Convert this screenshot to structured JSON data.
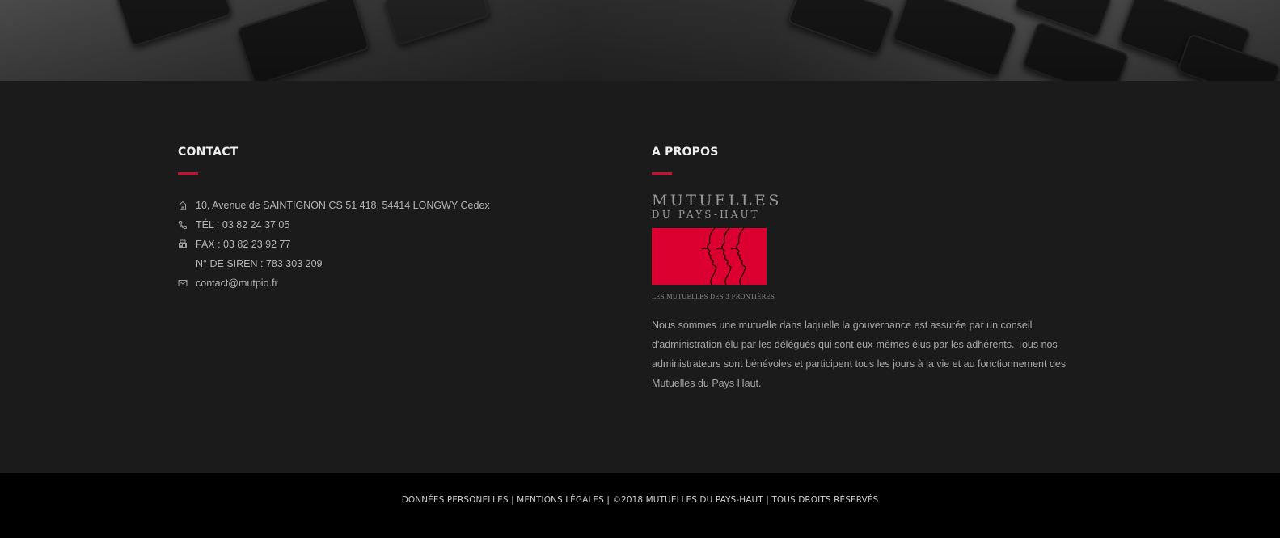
{
  "contact": {
    "title": "CONTACT",
    "items": [
      {
        "icon": "home-icon",
        "text": "10, Avenue de SAINTIGNON CS 51 418, 54414 LONGWY Cedex"
      },
      {
        "icon": "phone-icon",
        "text": "TÉL : 03 82 24 37 05"
      },
      {
        "icon": "fax-icon",
        "text": "FAX : 03 82 23 92 77"
      },
      {
        "icon": "",
        "text": "N° DE SIREN : 783 303 209"
      },
      {
        "icon": "mail-icon",
        "text": "contact@mutpio.fr"
      }
    ]
  },
  "about": {
    "title": "A PROPOS",
    "logo": {
      "line1": "MUTUELLES",
      "line2": "DU PAYS-HAUT",
      "tagline": "LES MUTUELLES DES 3 FRONTIÈRES"
    },
    "text": "Nous sommes une mutuelle dans laquelle la gouvernance est assurée par un conseil d'administration élu par les délégués qui sont eux-mêmes élus par les adhérents. Tous nos administrateurs sont bénévoles et participent tous les jours à la vie et au fonctionnement des Mutuelles du Pays Haut."
  },
  "bottom": {
    "link1": "DONNÉES PERSONELLES",
    "link2": "MENTIONS LÉGALES",
    "copyright": "©2018 MUTUELLES DU PAYS-HAUT",
    "rights": "TOUS DROITS RÉSERVÉS",
    "separator": "|"
  },
  "colors": {
    "accent": "#c8102e",
    "logo_red": "#dc0030",
    "footer_bg": "#1b1b1c",
    "bottom_bg": "#000000"
  }
}
